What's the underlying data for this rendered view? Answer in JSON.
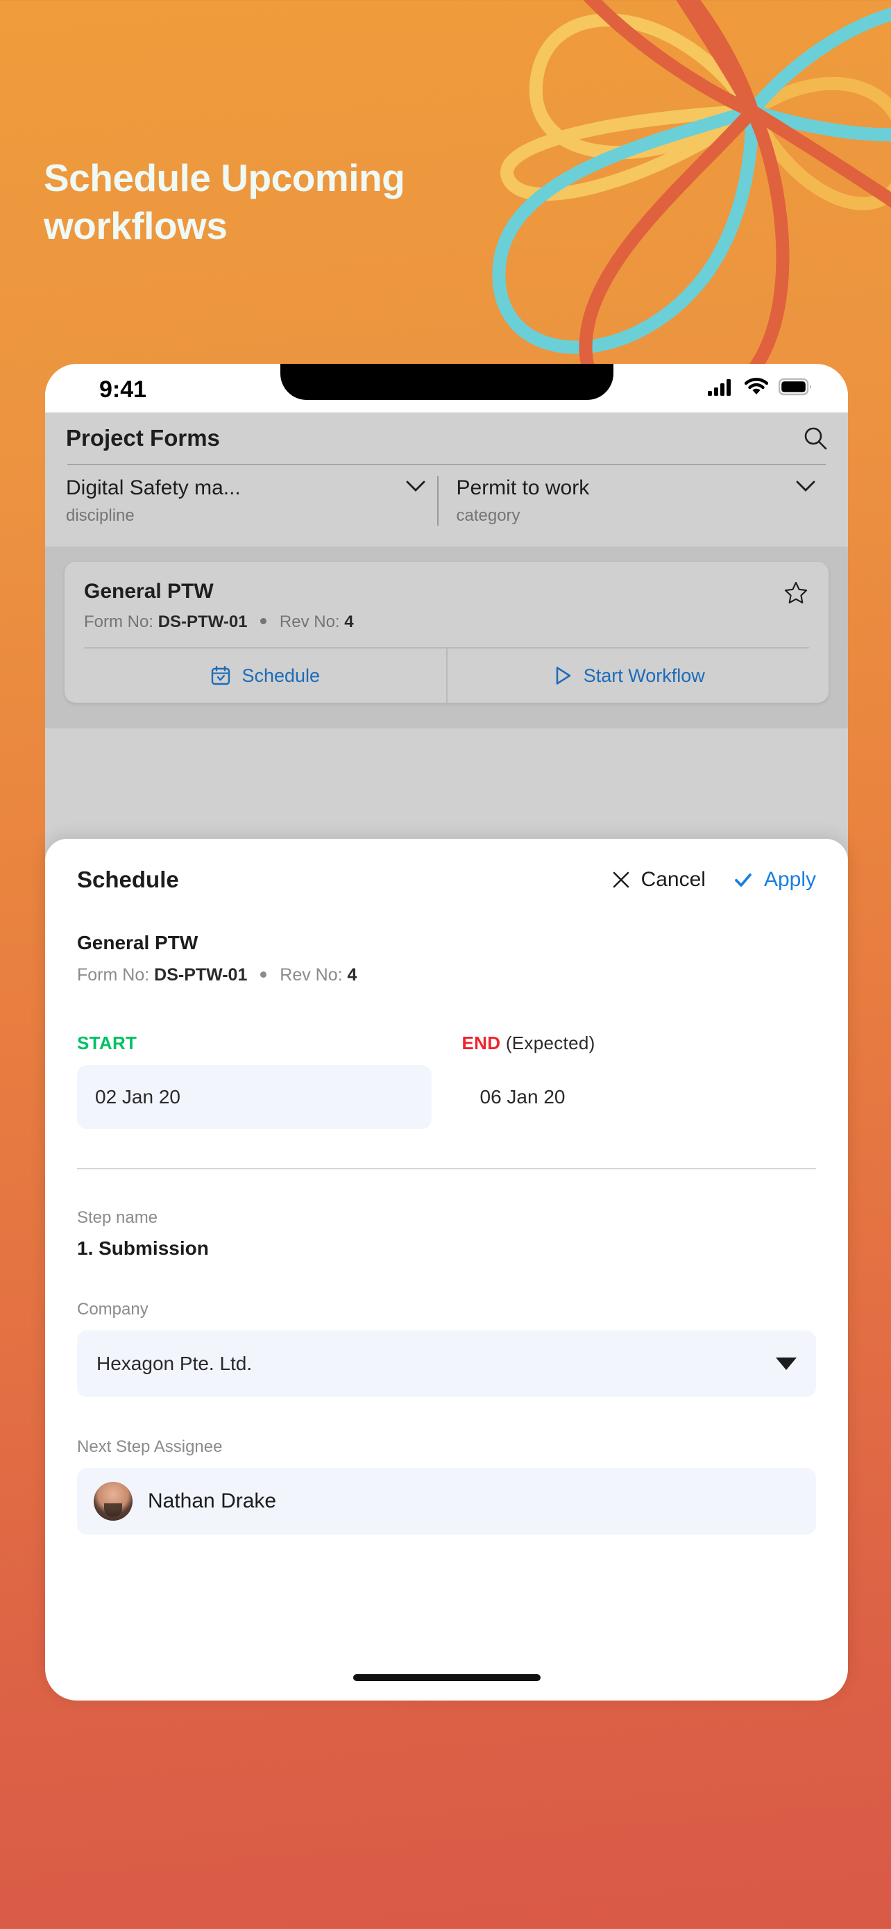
{
  "promo": {
    "headline_line1": "Schedule Upcoming",
    "headline_line2": "workflows",
    "bg_top_color": "#EE9C3C",
    "bg_bottom_color": "#D95947",
    "headline_color": "#EFF9F6",
    "petal_colors": [
      "#F5C45E",
      "#6BCFD8",
      "#E0613E"
    ]
  },
  "status_bar": {
    "time": "9:41",
    "icons": [
      "cellular-signal-icon",
      "wifi-icon",
      "battery-icon"
    ]
  },
  "app": {
    "header": {
      "title": "Project Forms",
      "search_icon": "search-icon"
    },
    "filters": [
      {
        "value": "Digital Safety ma...",
        "label": "discipline",
        "icon": "chevron-down-icon"
      },
      {
        "value": "Permit to work",
        "label": "category",
        "icon": "chevron-down-icon"
      }
    ],
    "form_card": {
      "title": "General PTW",
      "form_no_label": "Form No:",
      "form_no": "DS-PTW-01",
      "rev_no_label": "Rev No:",
      "rev_no": "4",
      "favorite_icon": "star-outline-icon",
      "actions": [
        {
          "label": "Schedule",
          "icon": "calendar-check-icon"
        },
        {
          "label": "Start Workflow",
          "icon": "play-outline-icon"
        }
      ]
    }
  },
  "sheet": {
    "title": "Schedule",
    "cancel_label": "Cancel",
    "cancel_icon": "close-x-icon",
    "apply_label": "Apply",
    "apply_icon": "check-icon",
    "apply_color": "#1A7FE0",
    "form_title": "General PTW",
    "form_no_label": "Form No:",
    "form_no": "DS-PTW-01",
    "rev_no_label": "Rev No:",
    "rev_no": "4",
    "start": {
      "label": "START",
      "label_color": "#00C264",
      "value": "02 Jan 20"
    },
    "end": {
      "label": "END",
      "label_suffix": " (Expected)",
      "label_color": "#F0232B",
      "value": "06 Jan 20"
    },
    "step": {
      "label": "Step name",
      "value": "1. Submission"
    },
    "company": {
      "label": "Company",
      "value": "Hexagon Pte. Ltd.",
      "icon": "caret-down-icon"
    },
    "assignee": {
      "label": "Next Step Assignee",
      "name": "Nathan Drake",
      "avatar": "user-avatar"
    }
  }
}
